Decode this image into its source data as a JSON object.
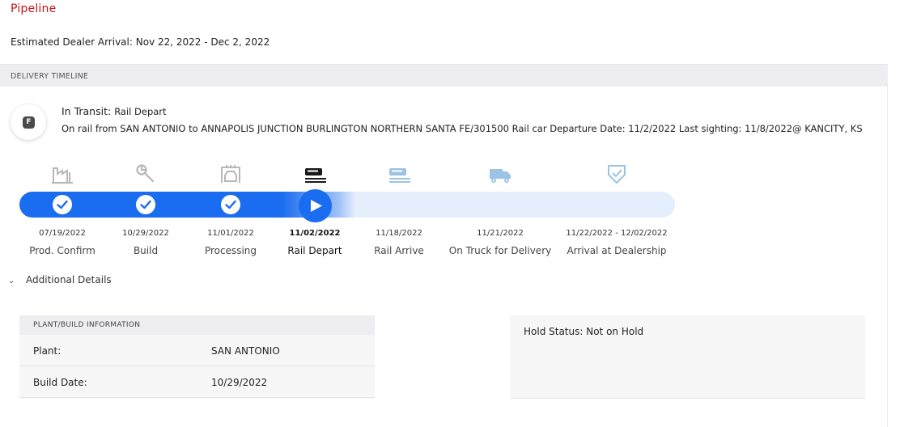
{
  "page": {
    "title": "Pipeline",
    "arrival_label": "Estimated Dealer Arrival:",
    "arrival_range": "Nov 22, 2022 - Dec 2, 2022"
  },
  "timeline": {
    "section_title": "DELIVERY TIMELINE",
    "badge_letter": "F",
    "status_main": "In Transit:",
    "status_sub": "Rail Depart",
    "status_detail": "On rail from SAN ANTONIO to ANNAPOLIS JUNCTION BURLINGTON NORTHERN SANTA FE/301500 Rail car Departure Date: 11/2/2022 Last sighting: 11/8/2022@ KANCITY, KS",
    "progress_color": "#1a6cf0",
    "stages": [
      {
        "label": "Prod. Confirm",
        "date": "07/19/2022",
        "icon": "factory-icon",
        "state": "complete"
      },
      {
        "label": "Build",
        "date": "10/29/2022",
        "icon": "wrench-icon",
        "state": "complete"
      },
      {
        "label": "Processing",
        "date": "11/01/2022",
        "icon": "car-wash-icon",
        "state": "complete"
      },
      {
        "label": "Rail Depart",
        "date": "11/02/2022",
        "icon": "train-depart-icon",
        "state": "current"
      },
      {
        "label": "Rail Arrive",
        "date": "11/18/2022",
        "icon": "train-arrive-icon",
        "state": "pending"
      },
      {
        "label": "On Truck for Delivery",
        "date": "11/21/2022",
        "icon": "truck-icon",
        "state": "pending"
      },
      {
        "label": "Arrival at Dealership",
        "date": "11/22/2022 - 12/02/2022",
        "icon": "shield-check-icon",
        "state": "pending"
      }
    ]
  },
  "details": {
    "toggle_label": "Additional Details",
    "plant_header": "PLANT/BUILD INFORMATION",
    "plant_label": "Plant:",
    "plant_value": "SAN ANTONIO",
    "build_date_label": "Build Date:",
    "build_date_value": "10/29/2022",
    "hold_status": "Hold Status: Not on Hold"
  }
}
